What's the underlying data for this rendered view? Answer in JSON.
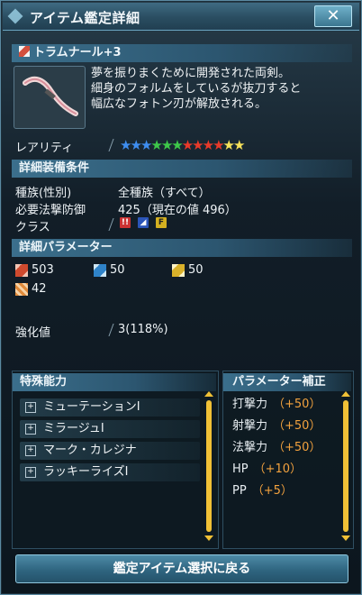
{
  "window": {
    "title": "アイテム鑑定詳細",
    "close_label": "✕"
  },
  "item": {
    "name": "トラムナール+3",
    "description": [
      "夢を振りまくために開発された両剣。",
      "細身のフォルムをしているが抜刀すると",
      "幅広なフォトン刃が解放される。"
    ],
    "rarity_label": "レアリティ",
    "rarity_stars": 13
  },
  "equip_conditions": {
    "header": "詳細装備条件",
    "race_label": "種族(性別)",
    "race_value": "全種族（すべて）",
    "req_label": "必要法撃防御",
    "req_value": "425（現在の値 496）",
    "class_label": "クラス"
  },
  "parameters": {
    "header": "詳細パラメーター",
    "striking": "503",
    "ranged": "50",
    "technique": "50",
    "extra": "42"
  },
  "grind": {
    "label": "強化値",
    "value": "3(118%)"
  },
  "special_abilities": {
    "header": "特殊能力",
    "items": [
      "ミューテーションⅠ",
      "ミラージュⅠ",
      "マーク・カレジナ",
      "ラッキーライズⅠ"
    ]
  },
  "param_bonus": {
    "header": "パラメーター補正",
    "items": [
      {
        "name": "打撃力",
        "value": "（+50）"
      },
      {
        "name": "射撃力",
        "value": "（+50）"
      },
      {
        "name": "法撃力",
        "value": "（+50）"
      },
      {
        "name": "HP",
        "value": "（+10）"
      },
      {
        "name": "PP",
        "value": "（+5）"
      }
    ]
  },
  "footer": {
    "back_label": "鑑定アイテム選択に戻る"
  },
  "colors": {
    "accent": "#3b6f8c",
    "bonus_value": "#f3a23e",
    "scroll": "#f0c036"
  }
}
